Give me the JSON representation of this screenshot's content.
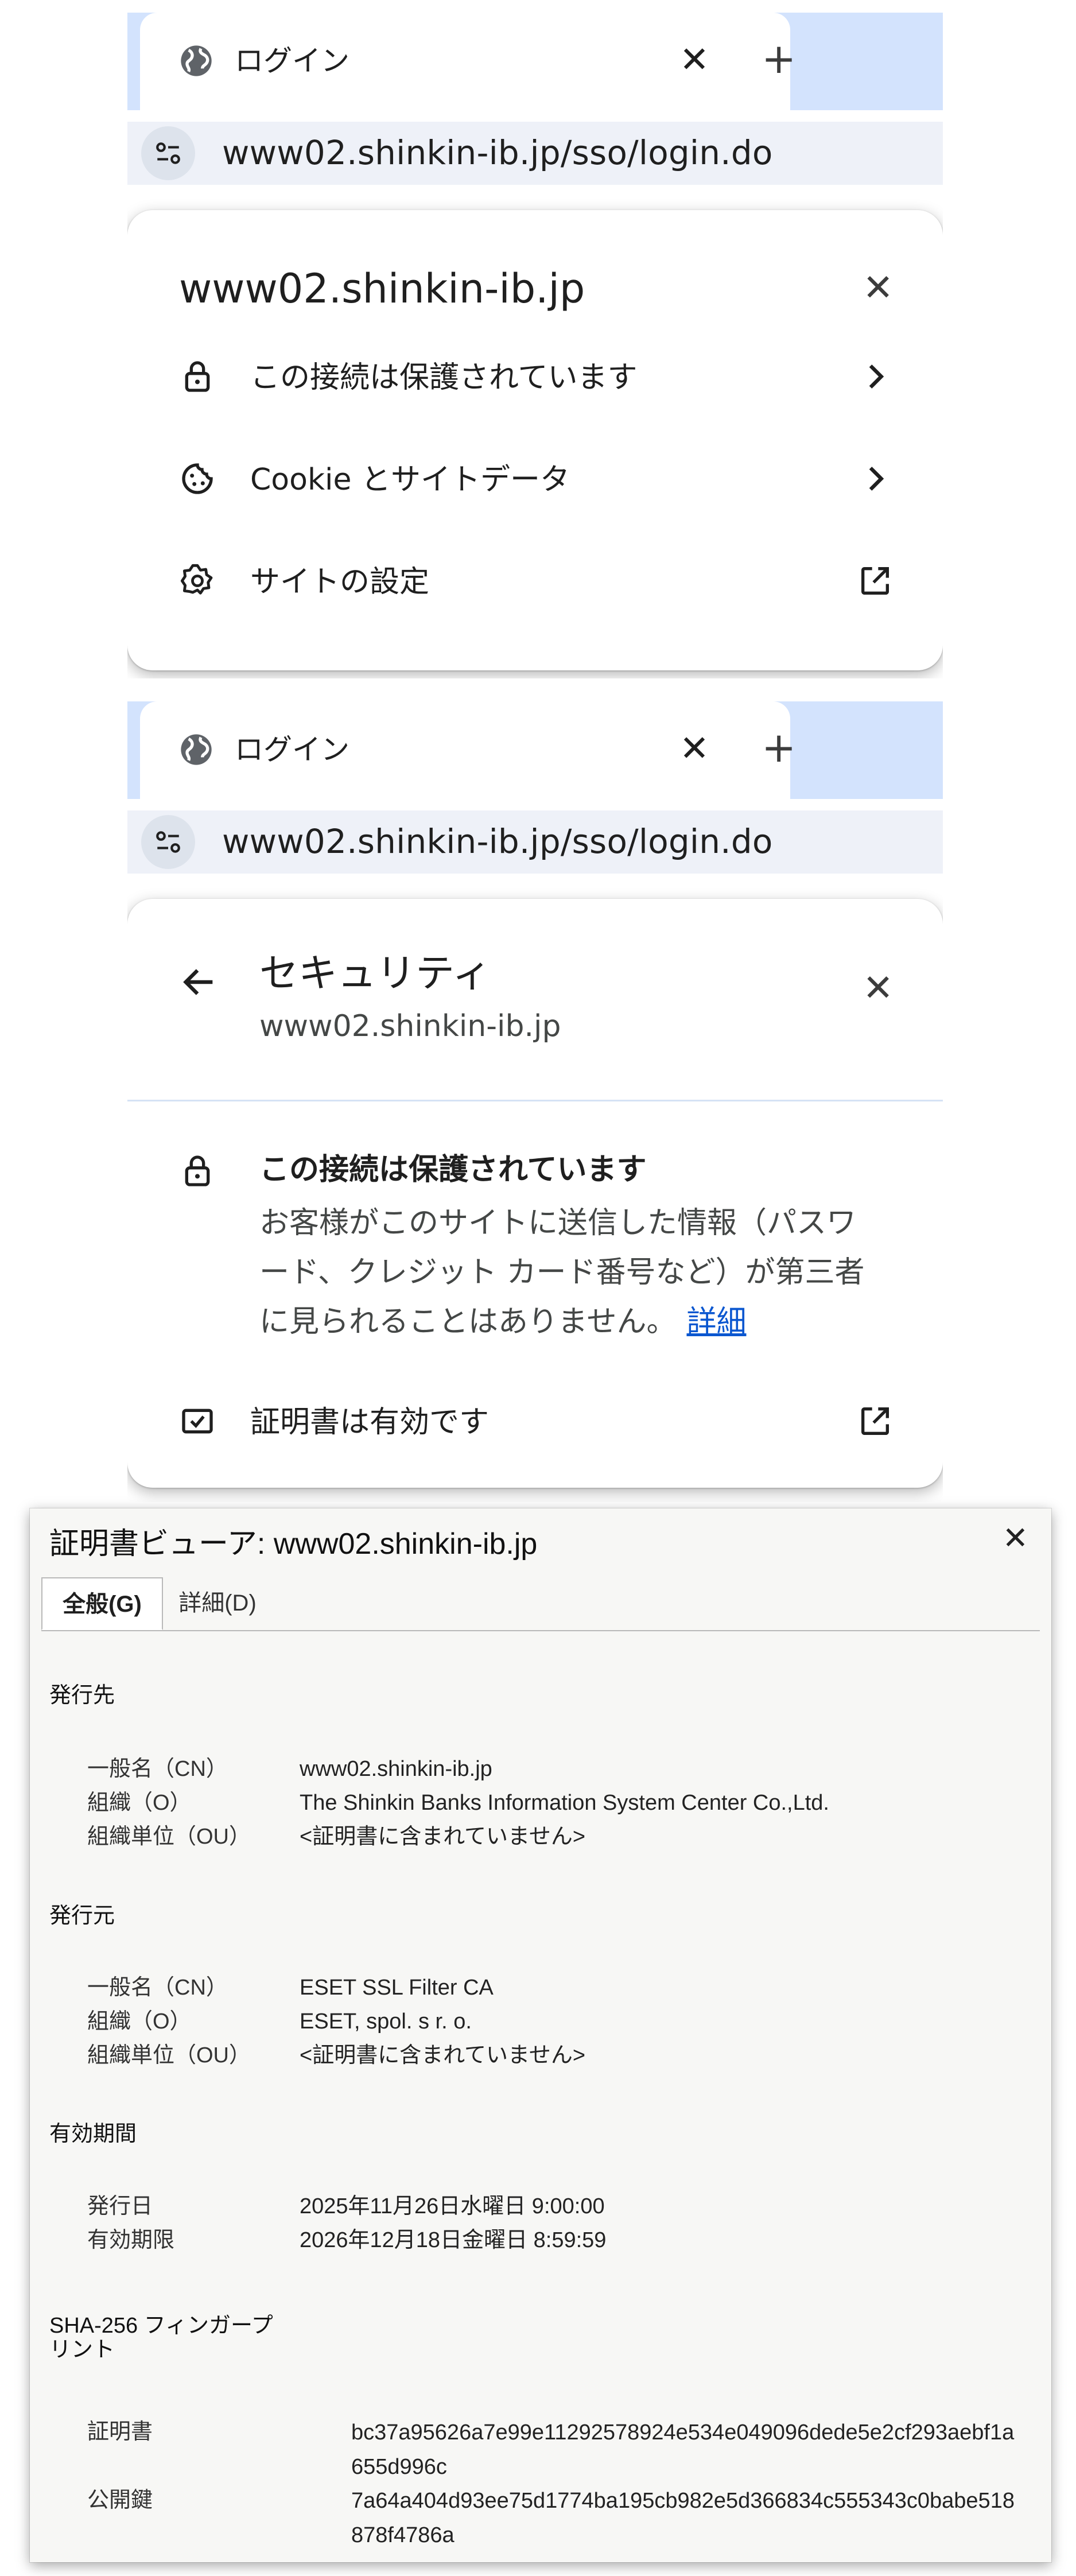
{
  "browser": {
    "tab_title": "ログイン",
    "tab_close": "✕",
    "new_tab": "+",
    "url": "www02.shinkin-ib.jp/sso/login.do"
  },
  "site_info": {
    "host": "www02.shinkin-ib.jp",
    "close": "✕",
    "rows": [
      {
        "label": "この接続は保護されています",
        "icon": "lock-icon",
        "end": "chevron-right-icon"
      },
      {
        "label": "Cookie とサイトデータ",
        "icon": "cookie-icon",
        "end": "chevron-right-icon"
      },
      {
        "label": "サイトの設定",
        "icon": "gear-icon",
        "end": "external-link-icon"
      }
    ]
  },
  "security": {
    "title": "セキュリティ",
    "subtitle": "www02.shinkin-ib.jp",
    "close": "✕",
    "connection_title": "この接続は保護されています",
    "connection_body": "お客様がこのサイトに送信した情報（パスワード、クレジット カード番号など）が第三者に見られることはありません。",
    "details_link": "詳細",
    "cert_row": "証明書は有効です"
  },
  "cert_viewer": {
    "title": "証明書ビューア: www02.shinkin-ib.jp",
    "close": "✕",
    "tabs": [
      "全般(G)",
      "詳細(D)"
    ],
    "issued_to": {
      "heading": "発行先",
      "fields": [
        {
          "key": "一般名（CN）",
          "value": "www02.shinkin-ib.jp"
        },
        {
          "key": "組織（O）",
          "value": "The Shinkin Banks Information System Center Co.,Ltd."
        },
        {
          "key": "組織単位（OU）",
          "value": "<証明書に含まれていません>"
        }
      ]
    },
    "issued_by": {
      "heading": "発行元",
      "fields": [
        {
          "key": "一般名（CN）",
          "value": "ESET SSL Filter CA"
        },
        {
          "key": "組織（O）",
          "value": "ESET, spol. s r. o."
        },
        {
          "key": "組織単位（OU）",
          "value": "<証明書に含まれていません>"
        }
      ]
    },
    "validity": {
      "heading": "有効期間",
      "fields": [
        {
          "key": "発行日",
          "value": "2025年11月26日水曜日 9:00:00"
        },
        {
          "key": "有効期限",
          "value": "2026年12月18日金曜日 8:59:59"
        }
      ]
    },
    "fingerprints": {
      "heading_line1": "SHA-256 フィンガープ",
      "heading_line2": "リント",
      "fields": [
        {
          "key": "証明書",
          "value": "bc37a95626a7e99e11292578924e534e049096dede5e2cf293aebf1a655d996c"
        },
        {
          "key": "公開鍵",
          "value": "7a64a404d93ee75d1774ba195cb982e5d366834c555343c0babe518878f4786a"
        }
      ]
    }
  }
}
